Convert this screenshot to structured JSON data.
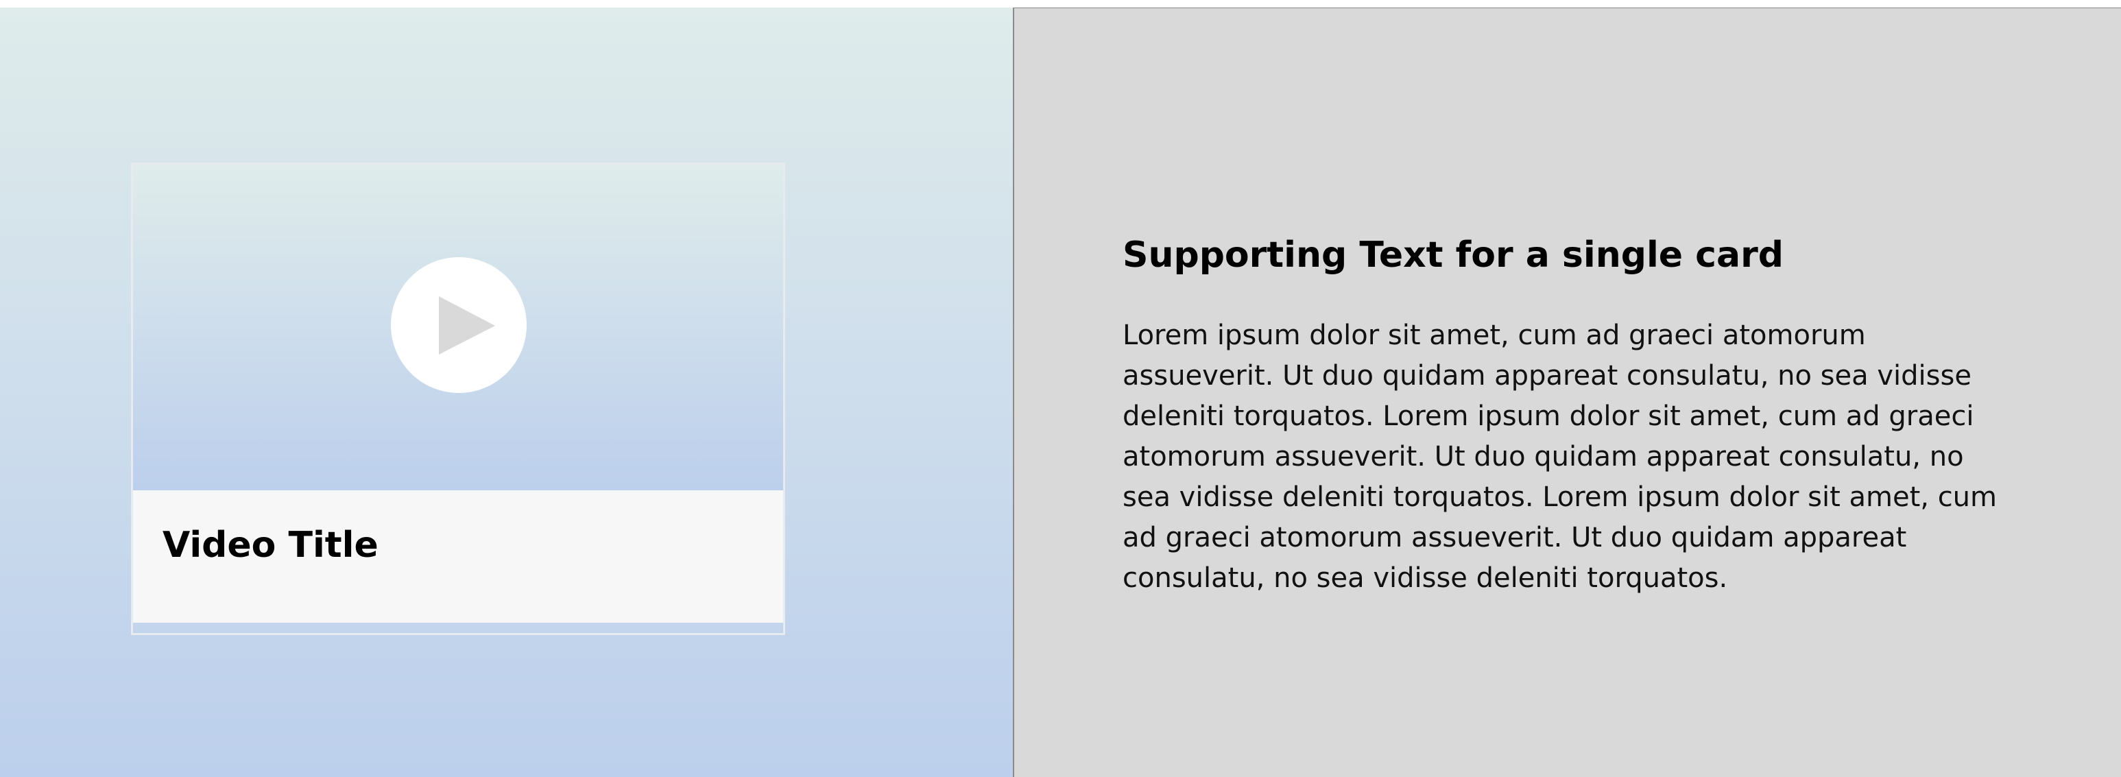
{
  "video_card": {
    "title": "Video Title",
    "play_icon": "play-icon"
  },
  "support": {
    "heading": "Supporting Text for a single card",
    "body": "Lorem ipsum dolor sit amet, cum ad graeci atomorum assueverit. Ut duo quidam appareat consulatu, no sea vidisse deleniti torquatos. Lorem ipsum dolor sit amet, cum ad graeci atomorum assueverit. Ut duo quidam appareat consulatu, no sea vidisse deleniti torquatos. Lorem ipsum dolor sit amet, cum ad graeci atomorum assueverit. Ut duo quidam appareat consulatu, no sea vidisse deleniti torquatos."
  },
  "colors": {
    "gradient_top": "#dfeceb",
    "gradient_bottom": "#bccfec",
    "right_panel_bg": "#d9d9d9",
    "caption_bg": "#f7f7f7",
    "play_triangle": "#d9d9d9"
  }
}
